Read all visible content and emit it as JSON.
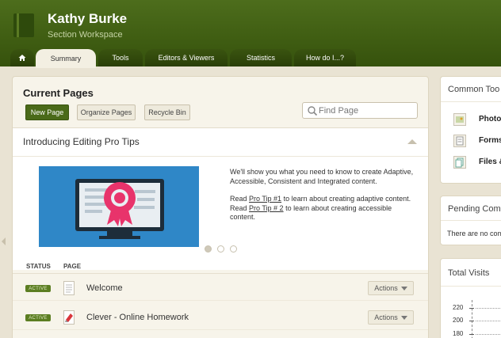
{
  "header": {
    "title": "Kathy Burke",
    "subtitle": "Section Workspace"
  },
  "nav": {
    "tabs": [
      {
        "label": "Summary",
        "active": true
      },
      {
        "label": "Tools"
      },
      {
        "label": "Editors & Viewers"
      },
      {
        "label": "Statistics"
      },
      {
        "label": "How do I...?"
      }
    ]
  },
  "pages": {
    "title": "Current Pages",
    "new_label": "New Page",
    "organize_label": "Organize Pages",
    "recycle_label": "Recycle Bin",
    "find_placeholder": "Find Page"
  },
  "tips": {
    "title": "Introducing Editing Pro Tips",
    "para1": "We'll show you what you need to know to create Adaptive, Accessible, Consistent and Integrated content.",
    "para2_a": "Read ",
    "link1": "Pro Tip #1",
    "para2_b": " to learn about creating adaptive content. Read ",
    "link2": "Pro Tip # 2",
    "para2_c": " to learn about creating accessible content."
  },
  "table": {
    "col_status": "STATUS",
    "col_page": "PAGE",
    "rows": [
      {
        "status": "ACTIVE",
        "name": "Welcome",
        "actions": "Actions"
      },
      {
        "status": "ACTIVE",
        "name": "Clever - Online Homework",
        "actions": "Actions"
      }
    ]
  },
  "common_tools": {
    "title": "Common Too",
    "items": [
      {
        "label": "Photo"
      },
      {
        "label": "Forms"
      },
      {
        "label": "Files &"
      }
    ]
  },
  "pending": {
    "title": "Pending Com",
    "message": "There are no com"
  },
  "visits": {
    "title": "Total Visits",
    "ticks": [
      "220",
      "200",
      "180"
    ]
  },
  "colors": {
    "header_green": "#4d6d1c",
    "active_badge": "#5c7e22",
    "banner_blue": "#2f87c7",
    "award_pink": "#e8336b"
  }
}
